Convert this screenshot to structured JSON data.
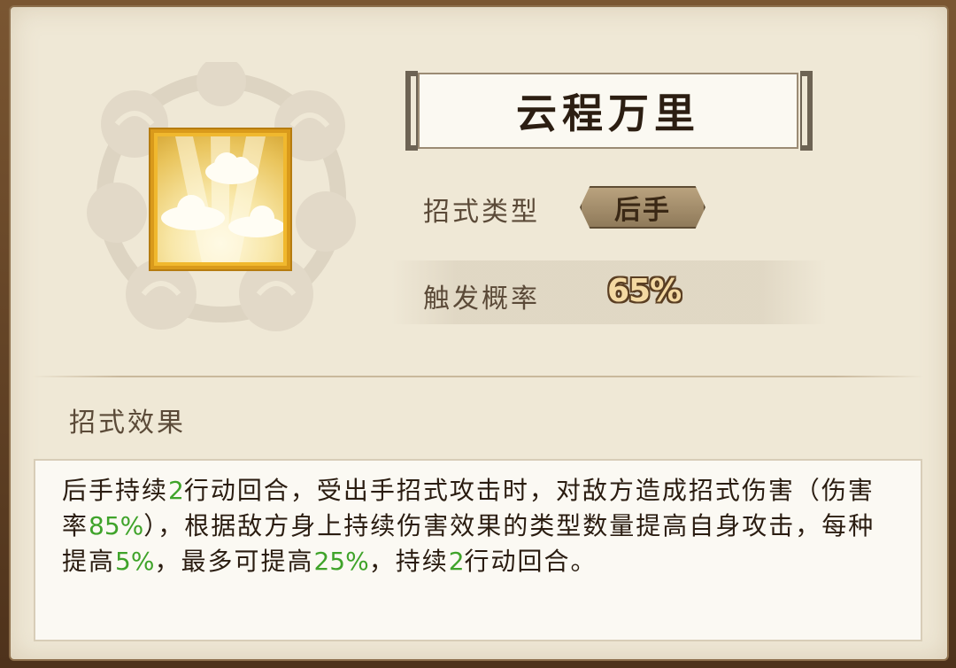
{
  "skill": {
    "name": "云程万里",
    "icon": "cloud-icon",
    "type_label": "招式类型",
    "type_value": "后手",
    "rate_label": "触发概率",
    "rate_value": "65%"
  },
  "effect": {
    "heading": "招式效果",
    "segments": {
      "s1": "后手持续",
      "v1": "2",
      "s2": "行动回合，受出手招式攻击时，对敌方造成招式伤害（伤害率",
      "v2": "85%",
      "s3": "），根据敌方身上持续伤害效果的类型数量提高自身攻击，每种提高",
      "v3": "5%",
      "s4": "，最多可提高",
      "v4": "25%",
      "s5": "，持续",
      "v5": "2",
      "s6": "行动回合。"
    }
  },
  "colors": {
    "highlight": "#3fa32a",
    "panel": "#efe8d6",
    "icon_border": "#d99a1b"
  }
}
